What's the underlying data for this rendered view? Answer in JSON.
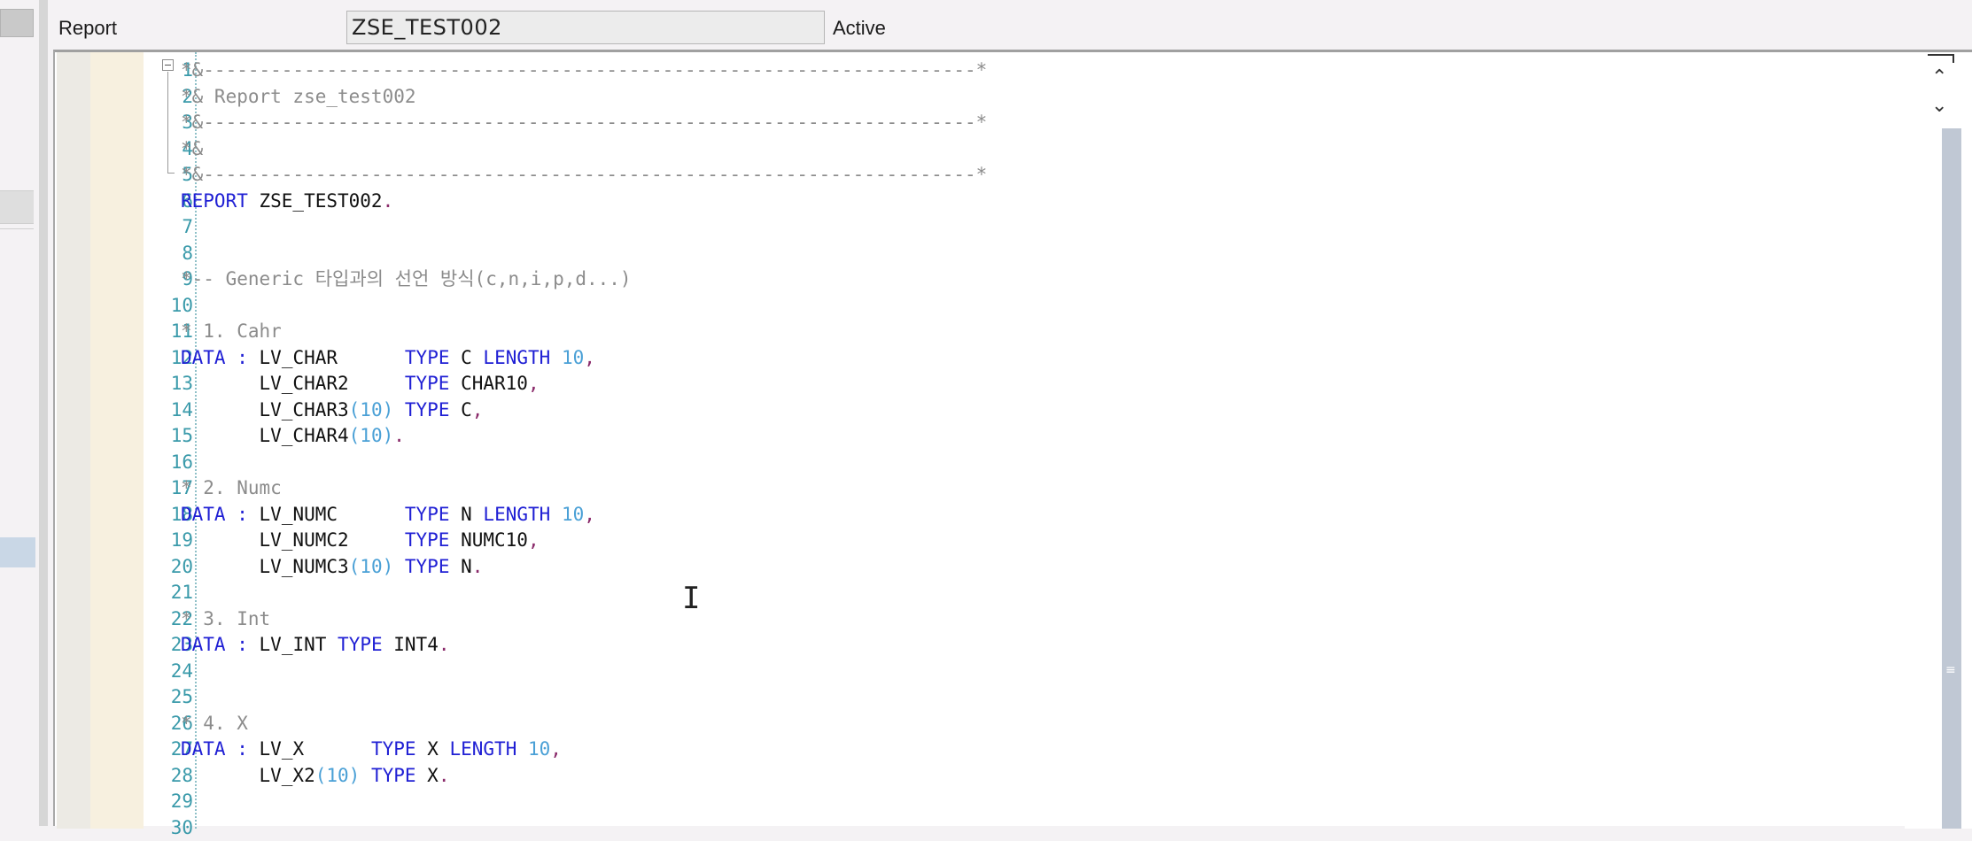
{
  "header": {
    "object_type_label": "Report",
    "program_name": "ZSE_TEST002",
    "status": "Active"
  },
  "gutter": {
    "line_numbers": [
      "1",
      "2",
      "3",
      "4",
      "5",
      "6",
      "7",
      "8",
      "9",
      "10",
      "11",
      "12",
      "13",
      "14",
      "15",
      "16",
      "17",
      "18",
      "19",
      "20",
      "21",
      "22",
      "23",
      "24",
      "25",
      "26",
      "27",
      "28",
      "29",
      "30"
    ]
  },
  "icons": {
    "fold": "collapse-minus-icon",
    "cursor": "ibeam-cursor-icon",
    "scroll_up": "chevron-up-icon",
    "scroll_down": "chevron-down-icon"
  },
  "colors": {
    "keyword": "#1f1fd4",
    "comment": "#8c8c8c",
    "number": "#4aa0d6",
    "line_number": "#3a9aaa",
    "punct": "#8a2a6a"
  },
  "code": {
    "lines": [
      [
        {
          "t": "*&---------------------------------------------------------------------*",
          "c": "cm"
        }
      ],
      [
        {
          "t": "*& Report zse_test002",
          "c": "cm"
        }
      ],
      [
        {
          "t": "*&---------------------------------------------------------------------*",
          "c": "cm"
        }
      ],
      [
        {
          "t": "*&",
          "c": "cm"
        }
      ],
      [
        {
          "t": "*&---------------------------------------------------------------------*",
          "c": "cm"
        }
      ],
      [
        {
          "t": "REPORT",
          "c": "kw"
        },
        {
          "t": " ZSE_TEST002",
          "c": "id"
        },
        {
          "t": ".",
          "c": "pt"
        }
      ],
      [],
      [],
      [
        {
          "t": "*-- Generic 타입과의 선언 방식(c,n,i,p,d...)",
          "c": "cm"
        }
      ],
      [],
      [
        {
          "t": "* 1. Cahr",
          "c": "cm"
        }
      ],
      [
        {
          "t": "DATA",
          "c": "kw"
        },
        {
          "t": " ",
          "c": "id"
        },
        {
          "t": ":",
          "c": "kw"
        },
        {
          "t": " LV_CHAR      ",
          "c": "id"
        },
        {
          "t": "TYPE",
          "c": "kw"
        },
        {
          "t": " C ",
          "c": "id"
        },
        {
          "t": "LENGTH",
          "c": "kw"
        },
        {
          "t": " ",
          "c": "id"
        },
        {
          "t": "10",
          "c": "nm"
        },
        {
          "t": ",",
          "c": "pt"
        }
      ],
      [
        {
          "t": "       LV_CHAR2     ",
          "c": "id"
        },
        {
          "t": "TYPE",
          "c": "kw"
        },
        {
          "t": " CHAR10",
          "c": "id"
        },
        {
          "t": ",",
          "c": "pt"
        }
      ],
      [
        {
          "t": "       LV_CHAR3",
          "c": "id"
        },
        {
          "t": "(10)",
          "c": "nm"
        },
        {
          "t": " ",
          "c": "id"
        },
        {
          "t": "TYPE",
          "c": "kw"
        },
        {
          "t": " C",
          "c": "id"
        },
        {
          "t": ",",
          "c": "pt"
        }
      ],
      [
        {
          "t": "       LV_CHAR4",
          "c": "id"
        },
        {
          "t": "(10)",
          "c": "nm"
        },
        {
          "t": ".",
          "c": "pt"
        }
      ],
      [],
      [
        {
          "t": "* 2. Numc",
          "c": "cm"
        }
      ],
      [
        {
          "t": "DATA",
          "c": "kw"
        },
        {
          "t": " ",
          "c": "id"
        },
        {
          "t": ":",
          "c": "kw"
        },
        {
          "t": " LV_NUMC      ",
          "c": "id"
        },
        {
          "t": "TYPE",
          "c": "kw"
        },
        {
          "t": " N ",
          "c": "id"
        },
        {
          "t": "LENGTH",
          "c": "kw"
        },
        {
          "t": " ",
          "c": "id"
        },
        {
          "t": "10",
          "c": "nm"
        },
        {
          "t": ",",
          "c": "pt"
        }
      ],
      [
        {
          "t": "       LV_NUMC2     ",
          "c": "id"
        },
        {
          "t": "TYPE",
          "c": "kw"
        },
        {
          "t": " NUMC10",
          "c": "id"
        },
        {
          "t": ",",
          "c": "pt"
        }
      ],
      [
        {
          "t": "       LV_NUMC3",
          "c": "id"
        },
        {
          "t": "(10)",
          "c": "nm"
        },
        {
          "t": " ",
          "c": "id"
        },
        {
          "t": "TYPE",
          "c": "kw"
        },
        {
          "t": " N",
          "c": "id"
        },
        {
          "t": ".",
          "c": "pt"
        }
      ],
      [],
      [
        {
          "t": "* 3. Int",
          "c": "cm"
        }
      ],
      [
        {
          "t": "DATA",
          "c": "kw"
        },
        {
          "t": " ",
          "c": "id"
        },
        {
          "t": ":",
          "c": "kw"
        },
        {
          "t": " LV_INT ",
          "c": "id"
        },
        {
          "t": "TYPE",
          "c": "kw"
        },
        {
          "t": " INT4",
          "c": "id"
        },
        {
          "t": ".",
          "c": "pt"
        }
      ],
      [],
      [],
      [
        {
          "t": "* 4. X",
          "c": "cm"
        }
      ],
      [
        {
          "t": "DATA",
          "c": "kw"
        },
        {
          "t": " ",
          "c": "id"
        },
        {
          "t": ":",
          "c": "kw"
        },
        {
          "t": " LV_X      ",
          "c": "id"
        },
        {
          "t": "TYPE",
          "c": "kw"
        },
        {
          "t": " X ",
          "c": "id"
        },
        {
          "t": "LENGTH",
          "c": "kw"
        },
        {
          "t": " ",
          "c": "id"
        },
        {
          "t": "10",
          "c": "nm"
        },
        {
          "t": ",",
          "c": "pt"
        }
      ],
      [
        {
          "t": "       LV_X2",
          "c": "id"
        },
        {
          "t": "(10)",
          "c": "nm"
        },
        {
          "t": " ",
          "c": "id"
        },
        {
          "t": "TYPE",
          "c": "kw"
        },
        {
          "t": " X",
          "c": "id"
        },
        {
          "t": ".",
          "c": "pt"
        }
      ],
      [],
      []
    ]
  }
}
